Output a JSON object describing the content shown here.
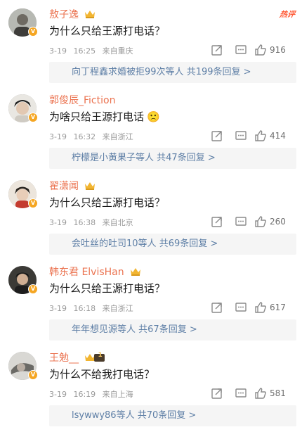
{
  "comments": [
    {
      "username": "敖子逸",
      "text": "为什么只给王源打电话？",
      "date": "3-19",
      "time": "16:25",
      "location": "来自重庆",
      "likes": "916",
      "replies_text": "向丁程鑫求婚被拒99次等人",
      "replies_count": "共199条回复 >",
      "badge": "crown",
      "tag": "热评"
    },
    {
      "username": "郭俊辰_Fiction",
      "text": "为啥只给王源打电话",
      "emoji": "🙁",
      "date": "3-19",
      "time": "16:32",
      "location": "来自浙江",
      "likes": "414",
      "replies_text": "柠檬是小黄果子等人",
      "replies_count": "共47条回复 >"
    },
    {
      "username": "翟潇闻",
      "text": "为什么只给王源打电话？",
      "date": "3-19",
      "time": "16:38",
      "location": "来自北京",
      "likes": "260",
      "replies_text": "会吐丝的吐司10等人",
      "replies_count": "共69条回复 >",
      "badge": "crown"
    },
    {
      "username": "韩东君 ElvisHan",
      "text": "为什么只给王源打电话？",
      "date": "3-19",
      "time": "16:18",
      "location": "来自浙江",
      "likes": "617",
      "replies_text": "年年想见源等人",
      "replies_count": "共67条回复 >",
      "badge": "crown"
    },
    {
      "username": "王勉__",
      "text": "为什么不给我打电话？",
      "date": "3-19",
      "time": "16:19",
      "location": "来自上海",
      "likes": "581",
      "replies_text": "lsywwy86等人",
      "replies_count": "共70条回复 >",
      "badge": "crown-level",
      "badge_level": "1"
    }
  ],
  "icons": {
    "share": "share-icon",
    "comment": "comment-icon",
    "like": "thumbs-up-icon",
    "verified": "verified-badge-icon"
  },
  "colors": {
    "username": "#eb7350",
    "reply_link": "#5e7fa6",
    "meta": "#9a9a9a",
    "hot_tag": "#ff5a36",
    "reply_bg": "#f5f5f5",
    "verified": "#f5a623"
  }
}
